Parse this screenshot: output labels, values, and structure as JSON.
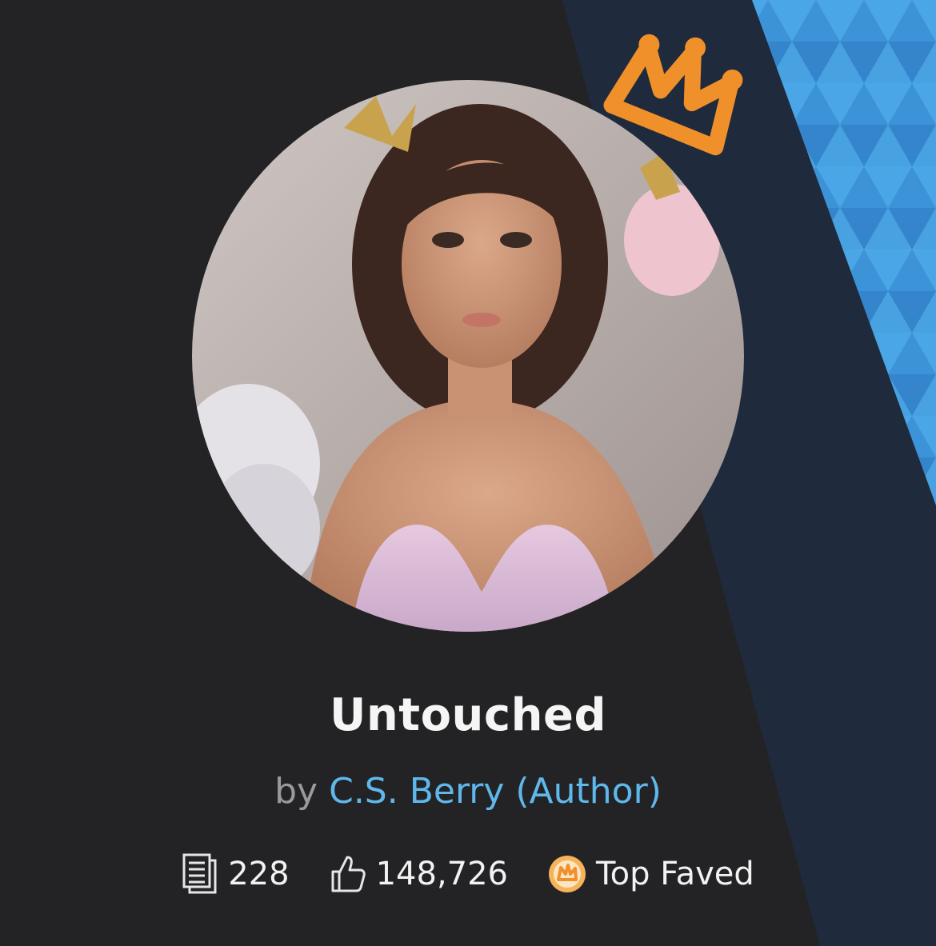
{
  "book": {
    "title": "Untouched",
    "by_label": "by",
    "author": "C.S. Berry (Author)"
  },
  "stats": {
    "pages": "228",
    "likes": "148,726",
    "badge": "Top Faved"
  },
  "icons": {
    "pages": "pages-icon",
    "likes": "thumbs-up-icon",
    "badge": "top-faved-badge-icon",
    "crown": "crown-icon"
  },
  "colors": {
    "background": "#232325",
    "accent_blue": "#5fb8ec",
    "crown_orange": "#f0902a",
    "panel_navy": "#1f2a3c",
    "stripe_blue": "#3e98dd"
  }
}
